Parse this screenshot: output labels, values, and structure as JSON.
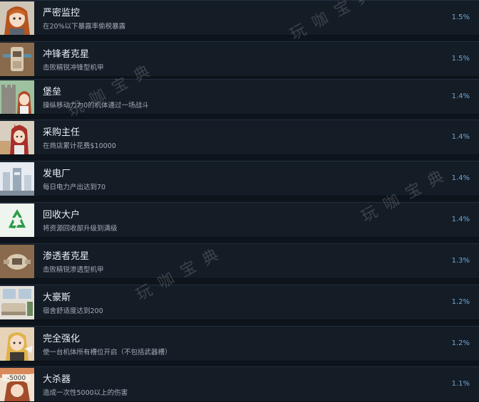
{
  "achievements": [
    {
      "title": "严密监控",
      "desc": "在20%以下暴露率偷税暴露",
      "pct": "1.5%",
      "icon": "girl-portrait-icon"
    },
    {
      "title": "冲锋者克星",
      "desc": "击败精锐冲锋型机甲",
      "pct": "1.5%",
      "icon": "mech-icon"
    },
    {
      "title": "堡垒",
      "desc": "操纵移动力为0的机体通过一场战斗",
      "pct": "1.4%",
      "icon": "castle-icon"
    },
    {
      "title": "采购主任",
      "desc": "在商店累计花费$10000",
      "pct": "1.4%",
      "icon": "girl-shopping-icon"
    },
    {
      "title": "发电厂",
      "desc": "每日电力产出达到70",
      "pct": "1.4%",
      "icon": "power-plant-icon"
    },
    {
      "title": "回收大户",
      "desc": "将资源回收部升级到满级",
      "pct": "1.4%",
      "icon": "recycle-icon"
    },
    {
      "title": "渗透者克星",
      "desc": "击败精锐渗透型机甲",
      "pct": "1.3%",
      "icon": "mech-icon"
    },
    {
      "title": "大豪斯",
      "desc": "宿舍舒适度达到200",
      "pct": "1.2%",
      "icon": "room-icon"
    },
    {
      "title": "完全强化",
      "desc": "使一台机体所有槽位开启（不包括武器槽）",
      "pct": "1.2%",
      "icon": "girl-portrait-icon"
    },
    {
      "title": "大杀器",
      "desc": "造成一次性5000以上的伤害",
      "pct": "1.1%",
      "icon": "damage-icon"
    }
  ],
  "watermark": "玩 咖 宝 典",
  "colors": {
    "accent": "#6ea9d6",
    "background": "#0e141b",
    "row": "#141c26"
  }
}
